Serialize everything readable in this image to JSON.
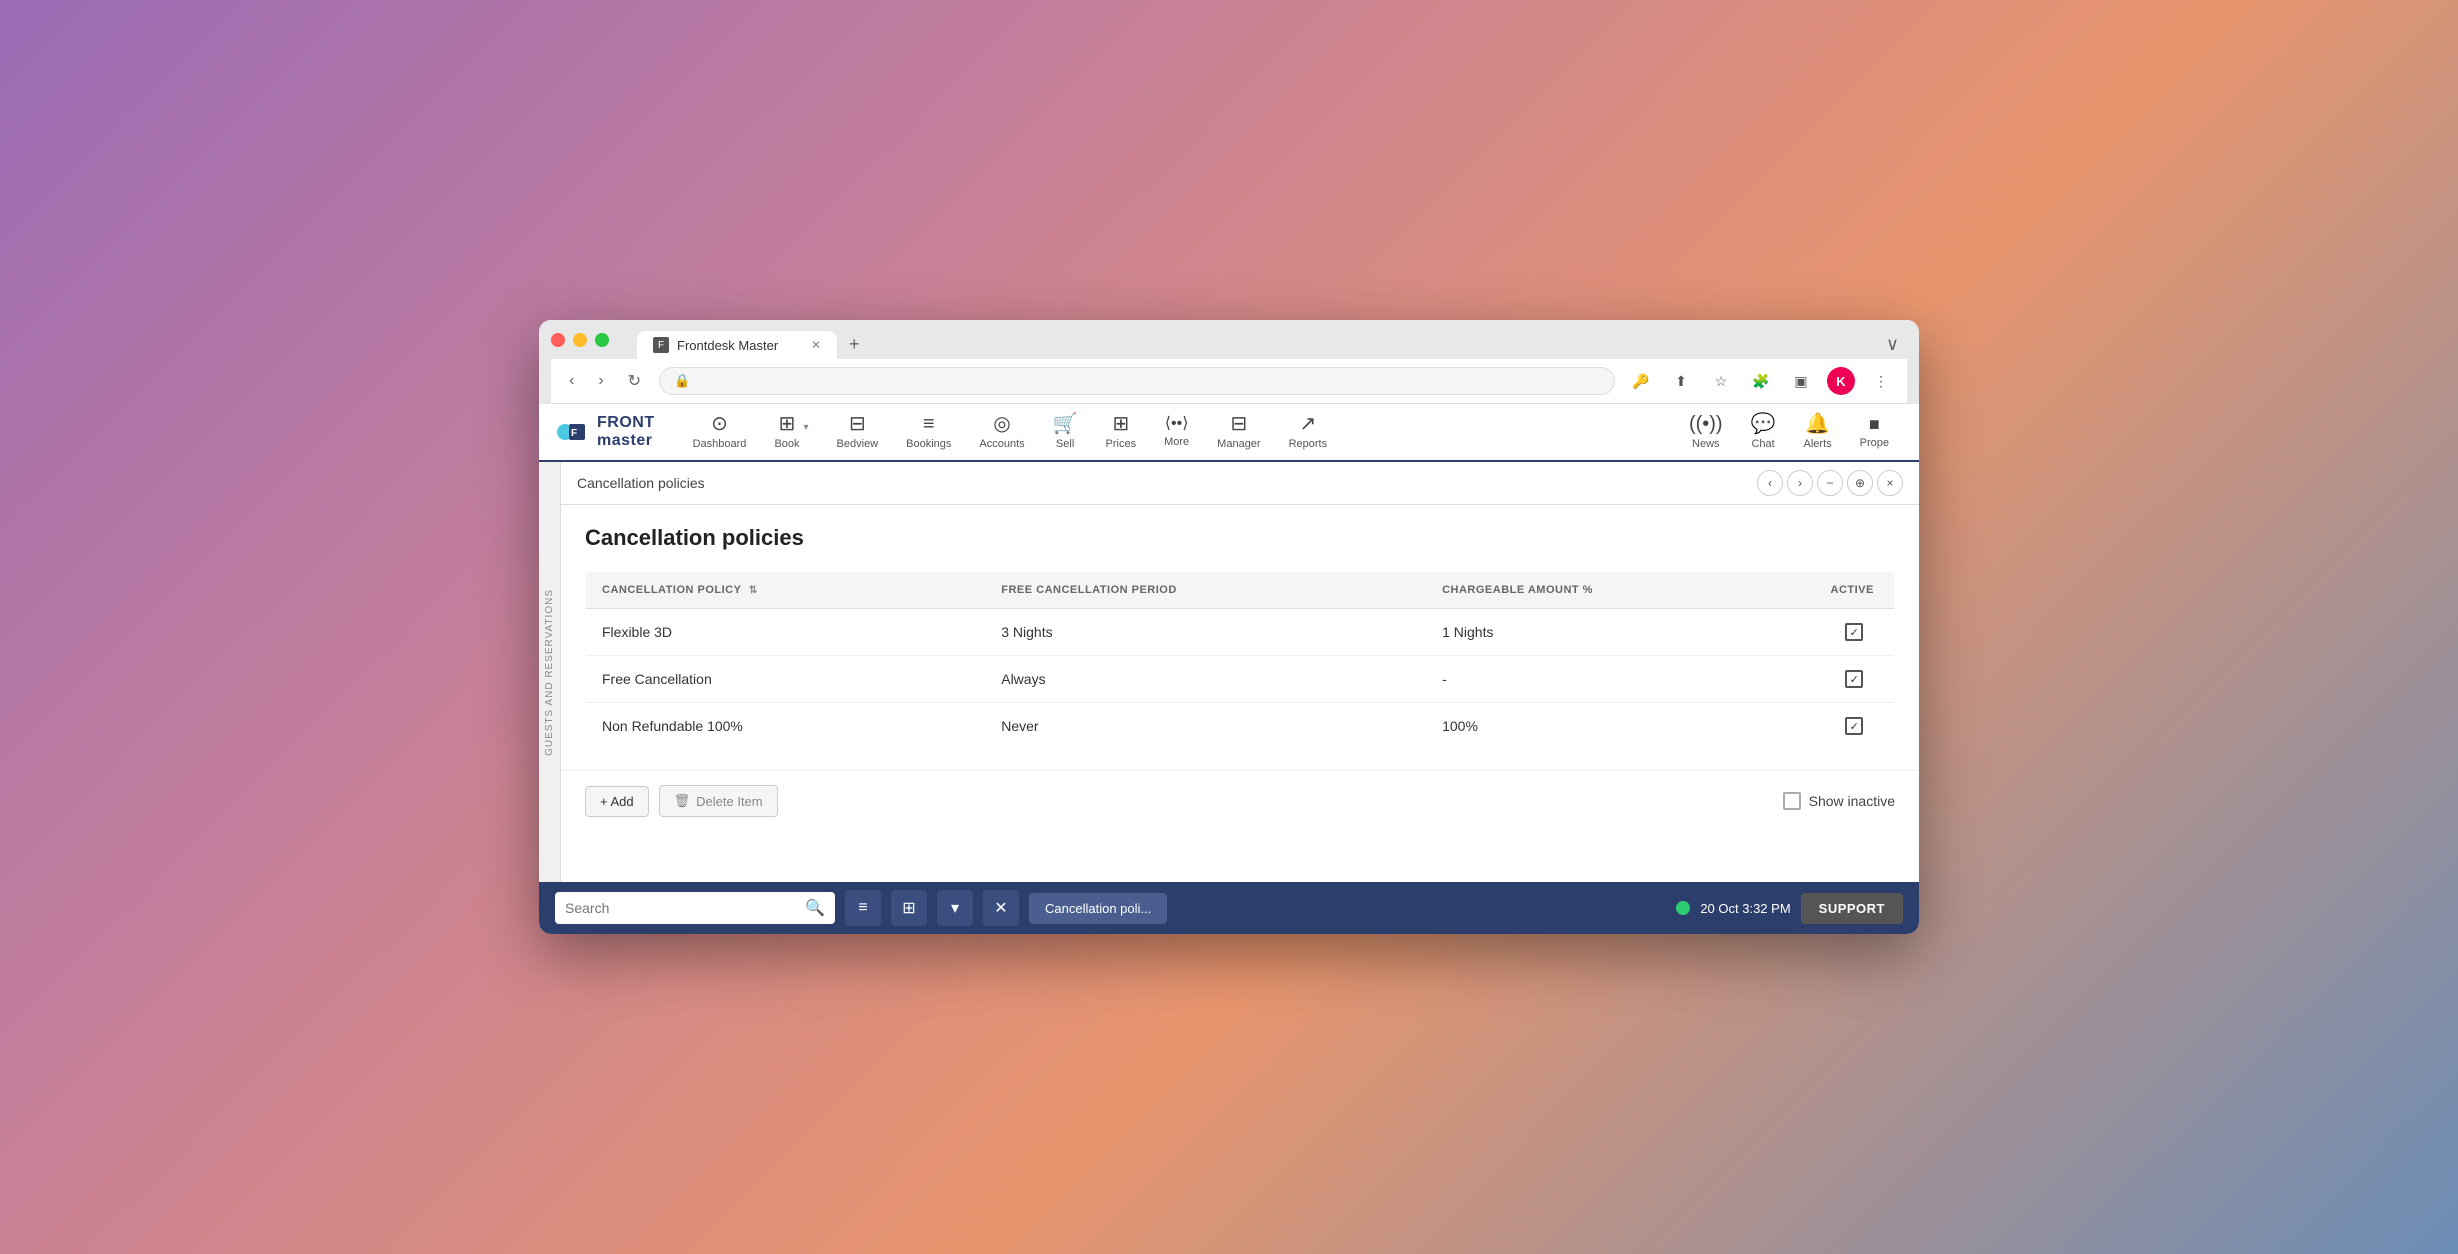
{
  "browser": {
    "tab_title": "Frontdesk Master",
    "new_tab_label": "+",
    "window_controls": {
      "red": "close",
      "yellow": "minimize",
      "green": "maximize"
    },
    "nav_back": "‹",
    "nav_forward": "›",
    "nav_refresh": "↻",
    "address_bar_icon": "🔒",
    "browser_menu": "⋮",
    "avatar_label": "K"
  },
  "nav": {
    "logo_top": "FRONT",
    "logo_bottom": "master",
    "items": [
      {
        "id": "dashboard",
        "label": "Dashboard",
        "icon": "⊙"
      },
      {
        "id": "book",
        "label": "Book",
        "icon": "⊞"
      },
      {
        "id": "bedview",
        "label": "Bedview",
        "icon": "⊟"
      },
      {
        "id": "bookings",
        "label": "Bookings",
        "icon": "≡"
      },
      {
        "id": "accounts",
        "label": "Accounts",
        "icon": "◎"
      },
      {
        "id": "sell",
        "label": "Sell",
        "icon": "🛒"
      },
      {
        "id": "prices",
        "label": "Prices",
        "icon": "⊞"
      },
      {
        "id": "more",
        "label": "More",
        "icon": "⟨⟩"
      },
      {
        "id": "manager",
        "label": "Manager",
        "icon": "⊟"
      },
      {
        "id": "reports",
        "label": "Reports",
        "icon": "↗"
      },
      {
        "id": "news",
        "label": "News",
        "icon": "((•))"
      },
      {
        "id": "chat",
        "label": "Chat",
        "icon": "💬"
      },
      {
        "id": "alerts",
        "label": "Alerts",
        "icon": "🔔"
      },
      {
        "id": "prope",
        "label": "Prope",
        "icon": "■"
      }
    ]
  },
  "sidebar": {
    "label": "GUESTS AND RESERVATIONS"
  },
  "page": {
    "header_title": "Cancellation policies",
    "section_title": "Cancellation policies",
    "nav_buttons": [
      "‹",
      "›",
      "−",
      "⊗",
      "×"
    ]
  },
  "table": {
    "columns": [
      {
        "id": "policy",
        "label": "CANCELLATION POLICY",
        "sortable": true
      },
      {
        "id": "period",
        "label": "FREE CANCELLATION PERIOD"
      },
      {
        "id": "amount",
        "label": "CHARGEABLE AMOUNT %"
      },
      {
        "id": "active",
        "label": "ACTIVE"
      }
    ],
    "rows": [
      {
        "policy": "Flexible 3D",
        "period": "3 Nights",
        "amount": "1 Nights",
        "active": true
      },
      {
        "policy": "Free Cancellation",
        "period": "Always",
        "amount": "-",
        "active": true
      },
      {
        "policy": "Non Refundable 100%",
        "period": "Never",
        "amount": "100%",
        "active": true
      }
    ]
  },
  "actions": {
    "add_label": "+ Add",
    "delete_label": "Delete Item",
    "show_inactive_label": "Show inactive"
  },
  "bottom_bar": {
    "search_placeholder": "Search",
    "current_page_label": "Cancellation poli...",
    "status_dot_color": "#2ecc71",
    "datetime": "20 Oct 3:32 PM",
    "support_label": "SUPPORT"
  }
}
